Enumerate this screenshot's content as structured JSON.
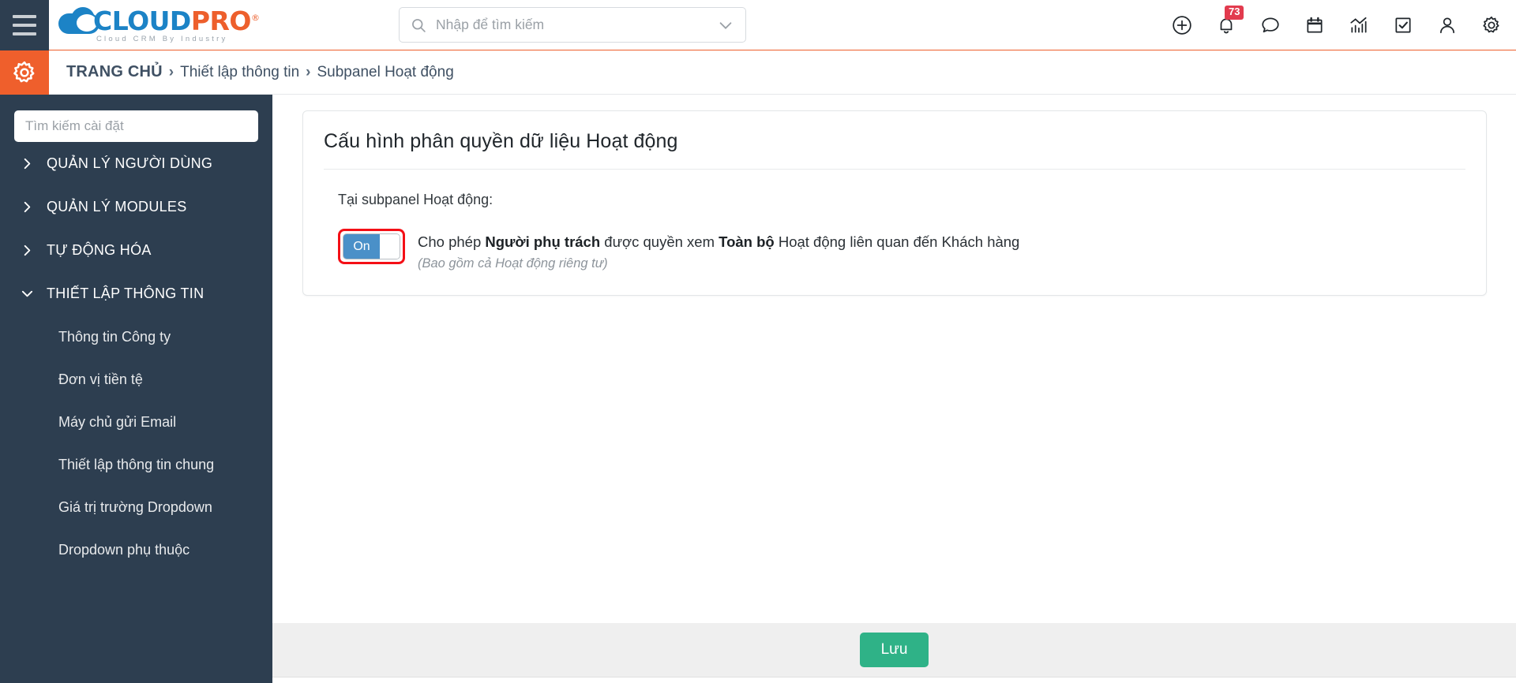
{
  "brand": {
    "name_part1": "CLOUD",
    "name_part2": "PRO",
    "registered": "®",
    "tagline": "Cloud CRM By Industry",
    "logo_blue": "#1c83c6",
    "logo_orange": "#ed5f2c"
  },
  "topbar": {
    "menu_icon": "hamburger-icon",
    "search": {
      "placeholder": "Nhập để tìm kiếm",
      "value": "",
      "icon": "search-icon",
      "caret": "chevron-down-icon"
    },
    "icons": [
      {
        "name": "plus-circle-icon",
        "label": "Thêm mới"
      },
      {
        "name": "bell-icon",
        "label": "Thông báo",
        "badge": "73"
      },
      {
        "name": "chat-icon",
        "label": "Tin nhắn"
      },
      {
        "name": "calendar-icon",
        "label": "Lịch"
      },
      {
        "name": "chart-icon",
        "label": "Báo cáo"
      },
      {
        "name": "checkbox-icon",
        "label": "Công việc"
      },
      {
        "name": "user-icon",
        "label": "Tài khoản"
      },
      {
        "name": "gear-icon",
        "label": "Cài đặt"
      }
    ],
    "accent_line_color": "#ed5f2c"
  },
  "breadcrumb": {
    "gear_icon": "gear-icon",
    "home": "TRANG CHỦ",
    "separator": "›",
    "items": [
      "Thiết lập thông tin",
      "Subpanel Hoạt động"
    ]
  },
  "sidebar": {
    "background": "#2d3e50",
    "search_placeholder": "Tìm kiếm cài đặt",
    "search_value": "",
    "groups": [
      {
        "label": "QUẢN LÝ NGƯỜI DÙNG",
        "expanded": false,
        "icon": "chevron-right-icon"
      },
      {
        "label": "QUẢN LÝ MODULES",
        "expanded": false,
        "icon": "chevron-right-icon"
      },
      {
        "label": "TỰ ĐỘNG HÓA",
        "expanded": false,
        "icon": "chevron-right-icon"
      },
      {
        "label": "THIẾT LẬP THÔNG TIN",
        "expanded": true,
        "icon": "chevron-down-icon"
      }
    ],
    "sub_items": [
      "Thông tin Công ty",
      "Đơn vị tiền tệ",
      "Máy chủ gửi Email",
      "Thiết lập thông tin chung",
      "Giá trị trường Dropdown",
      "Dropdown phụ thuộc"
    ]
  },
  "main": {
    "card_title": "Cấu hình phân quyền dữ liệu Hoạt động",
    "section_label": "Tại subpanel Hoạt động:",
    "setting": {
      "toggle_state": "On",
      "toggle_highlight_color": "#f40f16",
      "toggle_on_color": "#4a90c8",
      "text_before": "Cho phép ",
      "bold1": "Người phụ trách",
      "text_middle": " được quyền xem ",
      "bold2": "Toàn bộ",
      "text_after": " Hoạt động liên quan đến Khách hàng",
      "note": "(Bao gồm cả Hoạt động riêng tư)"
    }
  },
  "footer": {
    "save_label": "Lưu",
    "save_color": "#2fb287",
    "background": "#efefef"
  }
}
